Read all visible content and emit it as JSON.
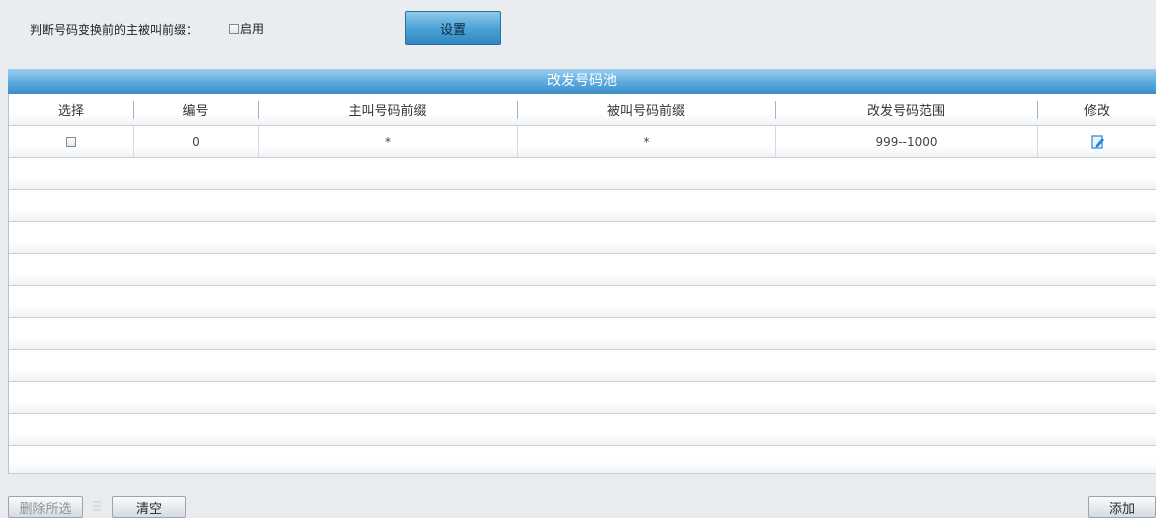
{
  "top": {
    "label": "判断号码变换前的主被叫前缀：",
    "enable_label": "启用",
    "set_button": "设置"
  },
  "panel": {
    "title": "改发号码池",
    "columns": [
      "选择",
      "编号",
      "主叫号码前缀",
      "被叫号码前缀",
      "改发号码范围",
      "修改"
    ],
    "rows": [
      {
        "id": "0",
        "caller_prefix": "*",
        "callee_prefix": "*",
        "range": "999--1000"
      }
    ]
  },
  "bottom": {
    "delete_selected": "删除所选",
    "clear": "清空",
    "add": "添加"
  },
  "colors": {
    "accent_blue": "#4fa3d6",
    "title_bar": "#5aa9de",
    "background": "#e8ecef",
    "edit_icon": "#2b86d2"
  }
}
